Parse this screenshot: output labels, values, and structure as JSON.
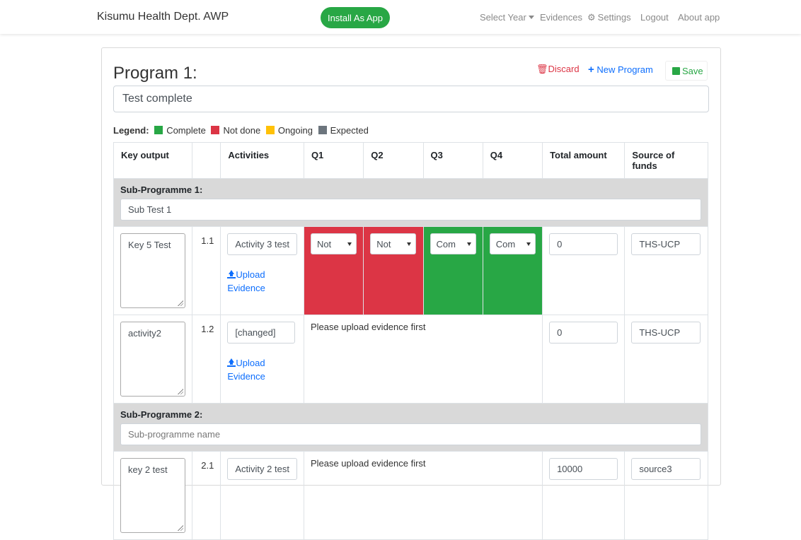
{
  "nav": {
    "brand": "Kisumu Health Dept. AWP",
    "install": "Install As App",
    "select_year": "Select Year",
    "evidences": "Evidences",
    "settings": "Settings",
    "logout": "Logout",
    "about": "About app"
  },
  "program": {
    "title": "Program 1:",
    "name": "Test complete",
    "discard": "Discard",
    "new_program": "New Program",
    "save": "Save"
  },
  "legend": {
    "label": "Legend:",
    "items": [
      {
        "label": "Complete",
        "color": "#28a745"
      },
      {
        "label": "Not done",
        "color": "#dc3545"
      },
      {
        "label": "Ongoing",
        "color": "#ffc107"
      },
      {
        "label": "Expected",
        "color": "#6c757d"
      }
    ]
  },
  "table": {
    "headers": [
      "Key output",
      "",
      "Activities",
      "Q1",
      "Q2",
      "Q3",
      "Q4",
      "Total amount",
      "Source of funds"
    ],
    "subprogrammes": [
      {
        "label": "Sub-Programme 1:",
        "name": "Sub Test 1",
        "rows": [
          {
            "key_output": "Key 5 Test",
            "number": "1.1",
            "activity": "Activity 3 test",
            "upload": "Upload Evidence",
            "quarters": [
              "Not",
              "Not",
              "Com",
              "Com"
            ],
            "total": "0",
            "source": "THS-UCP"
          },
          {
            "key_output": "activity2",
            "number": "1.2",
            "activity": "[changed]",
            "upload": "Upload Evidence",
            "message": "Please upload evidence first",
            "total": "0",
            "source": "THS-UCP"
          }
        ]
      },
      {
        "label": "Sub-Programme 2:",
        "placeholder": "Sub-programme name",
        "rows": [
          {
            "key_output": "key 2 test",
            "number": "2.1",
            "activity": "Activity 2 test",
            "message": "Please upload evidence first",
            "total": "10000",
            "source": "source3"
          }
        ]
      }
    ]
  }
}
